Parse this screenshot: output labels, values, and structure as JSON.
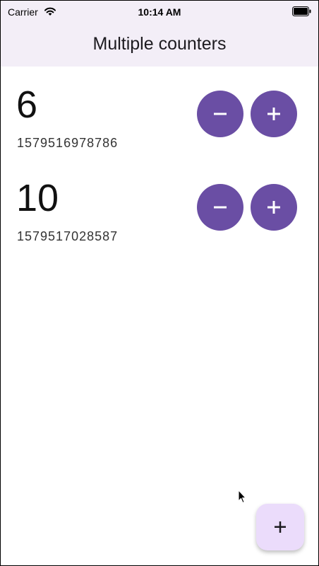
{
  "status_bar": {
    "carrier": "Carrier",
    "time": "10:14 AM",
    "icons": [
      "wifi-icon",
      "battery-icon"
    ]
  },
  "app_bar": {
    "title": "Multiple counters"
  },
  "counters": [
    {
      "value": "6",
      "id": "1579516978786"
    },
    {
      "value": "10",
      "id": "1579517028587"
    }
  ],
  "buttons": {
    "decrement_icon": "minus-icon",
    "increment_icon": "plus-icon",
    "add_counter_icon": "plus-icon"
  },
  "colors": {
    "accent": "#6a4ea4",
    "fab_background": "#ebdcfb",
    "app_bar_background": "#f3eef7"
  }
}
